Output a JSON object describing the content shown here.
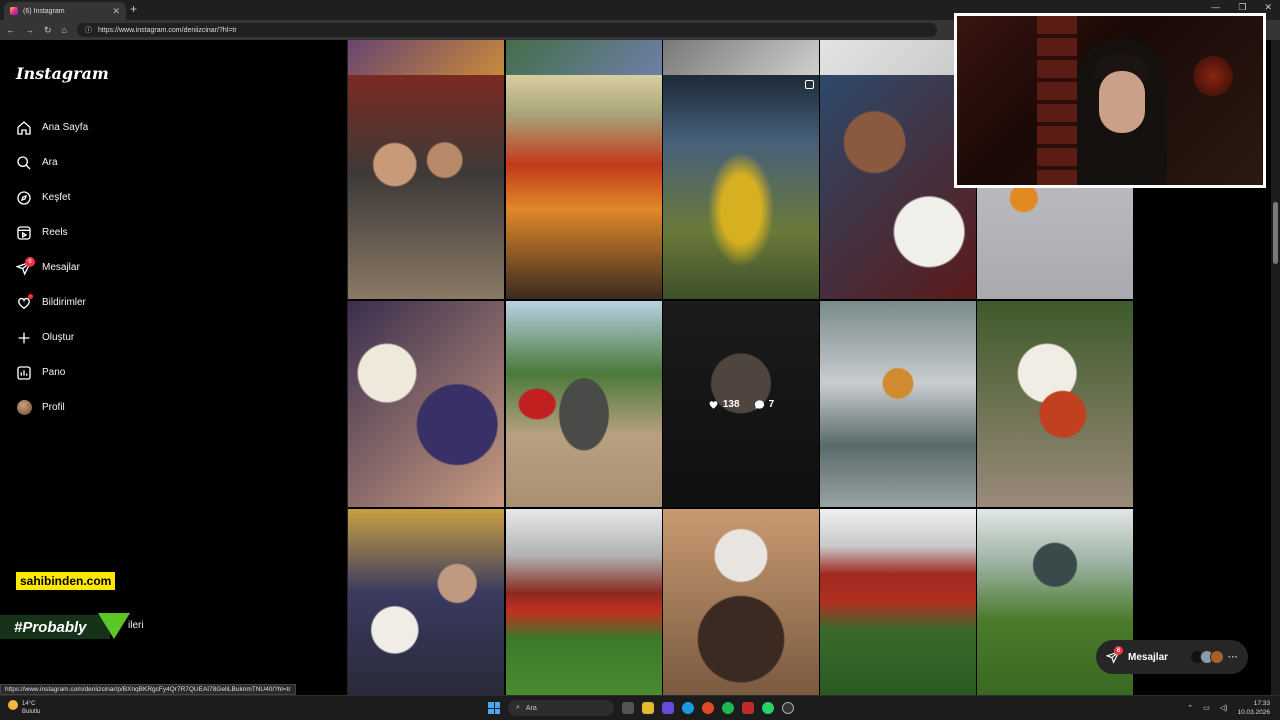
{
  "browser": {
    "tab_title": "(6) Instagram",
    "tab_close": "✕",
    "new_tab": "+",
    "window_controls": [
      "—",
      "❐",
      "✕"
    ],
    "url": "https://www.instagram.com/deniizcinar/?hl=tr",
    "status_url": "https://www.instagram.com/deniizcinar/p/BXnqBKRgcFy4Qr7R7QUEAI78GeliLBuknmTNU40/?hl=tr"
  },
  "sidebar": {
    "logo": "Instagram",
    "items": [
      {
        "label": "Ana Sayfa",
        "icon": "home-icon"
      },
      {
        "label": "Ara",
        "icon": "search-icon"
      },
      {
        "label": "Keşfet",
        "icon": "compass-icon"
      },
      {
        "label": "Reels",
        "icon": "reels-icon"
      },
      {
        "label": "Mesajlar",
        "icon": "messenger-icon",
        "badge": "6"
      },
      {
        "label": "Bildirimler",
        "icon": "heart-icon",
        "dot": true
      },
      {
        "label": "Oluştur",
        "icon": "plus-icon"
      },
      {
        "label": "Pano",
        "icon": "dashboard-icon"
      },
      {
        "label": "Profil",
        "icon": "avatar"
      }
    ],
    "more_label": "ileri"
  },
  "overlays": {
    "sponsor": "sahibinden.com",
    "hashtag": "#Probably"
  },
  "hover_post": {
    "likes": "138",
    "comments": "7"
  },
  "messages_pill": {
    "label": "Mesajlar",
    "badge": "6",
    "more": "···"
  },
  "taskbar": {
    "temperature": "14°C",
    "weather": "Bulutlu",
    "search_placeholder": "Ara",
    "time": "17:33",
    "date": "10.03.2026"
  },
  "colors": {
    "accent_red": "#ff3040",
    "background": "#000000",
    "sponsor_yellow": "#ffe800"
  }
}
